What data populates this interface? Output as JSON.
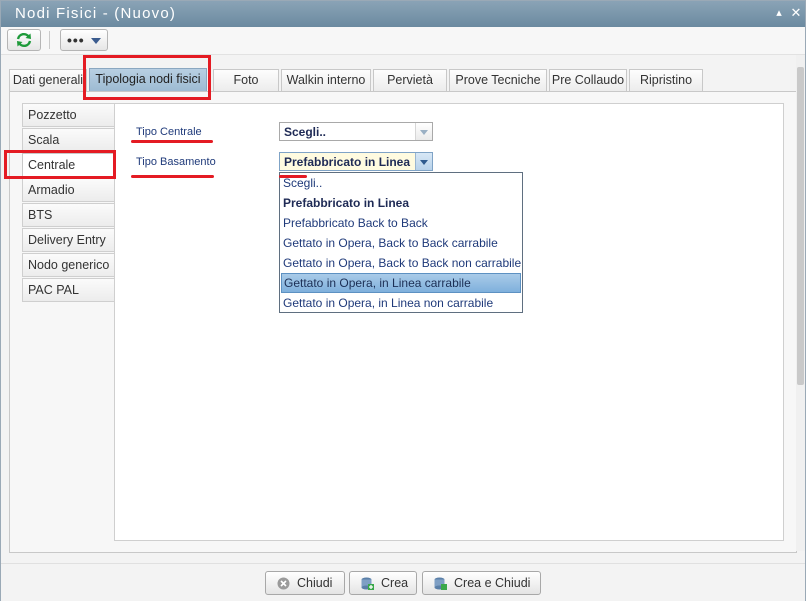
{
  "window": {
    "title": "Nodi Fisici - (Nuovo)",
    "minimize_glyph": "▴",
    "close_glyph": "✕"
  },
  "toolbar": {
    "refresh_icon": "refresh-icon",
    "more_label": "•••"
  },
  "tabs": [
    {
      "label": "Dati generali",
      "active": false
    },
    {
      "label": "Tipologia nodi fisici",
      "active": true
    },
    {
      "label": "Foto",
      "active": false
    },
    {
      "label": "Walkin interno",
      "active": false
    },
    {
      "label": "Pervietà",
      "active": false
    },
    {
      "label": "Prove Tecniche",
      "active": false
    },
    {
      "label": "Pre Collaudo",
      "active": false
    },
    {
      "label": "Ripristino",
      "active": false
    }
  ],
  "side_nav": [
    {
      "label": "Pozzetto",
      "active": false
    },
    {
      "label": "Scala",
      "active": false
    },
    {
      "label": "Centrale",
      "active": true
    },
    {
      "label": "Armadio",
      "active": false
    },
    {
      "label": "BTS",
      "active": false
    },
    {
      "label": "Delivery Entry",
      "active": false
    },
    {
      "label": "Nodo generico",
      "active": false
    },
    {
      "label": "PAC PAL",
      "active": false
    }
  ],
  "form": {
    "tipo_centrale": {
      "label": "Tipo Centrale",
      "value": "Scegli.."
    },
    "tipo_basamento": {
      "label": "Tipo Basamento",
      "value": "Prefabbricato in Linea",
      "open": true,
      "options": [
        {
          "label": "Scegli..",
          "selected": false,
          "hover": false
        },
        {
          "label": "Prefabbricato in Linea",
          "selected": true,
          "hover": false
        },
        {
          "label": "Prefabbricato Back to Back",
          "selected": false,
          "hover": false
        },
        {
          "label": "Gettato in Opera, Back to Back carrabile",
          "selected": false,
          "hover": false
        },
        {
          "label": "Gettato in Opera, Back to Back non carrabile",
          "selected": false,
          "hover": false
        },
        {
          "label": "Gettato in Opera, in Linea carrabile",
          "selected": false,
          "hover": true
        },
        {
          "label": "Gettato in Opera, in Linea non carrabile",
          "selected": false,
          "hover": false
        }
      ]
    }
  },
  "footer": {
    "close_label": "Chiudi",
    "create_label": "Crea",
    "create_close_label": "Crea e Chiudi"
  },
  "colors": {
    "annotation_red": "#e41b23",
    "titlebar": "#7893a8",
    "active_tab": "#a9c4da",
    "hover_option": "#8dbbe2"
  }
}
